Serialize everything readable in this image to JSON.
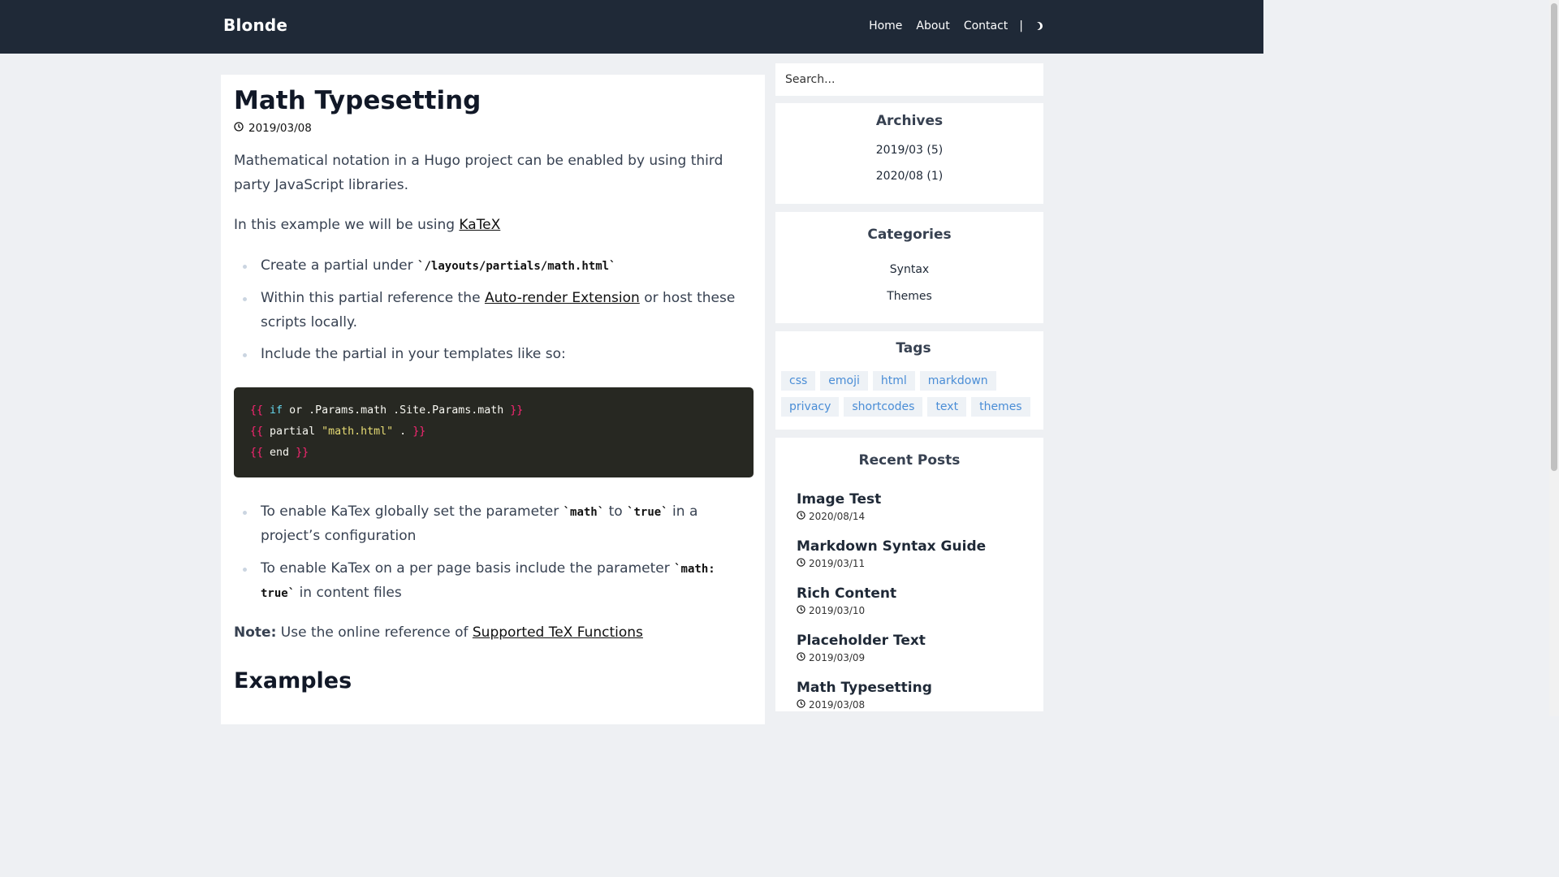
{
  "header": {
    "brand": "Blonde",
    "nav": [
      "Home",
      "About",
      "Contact"
    ],
    "separator": "|"
  },
  "article": {
    "title": "Math Typesetting",
    "date": "2019/03/08",
    "intro": "Mathematical notation in a Hugo project can be enabled by using third party JavaScript libraries.",
    "example_prefix": "In this example we will be using",
    "example_link": "KaTeX",
    "bullet1_text": "Create a partial under",
    "bullet1_code": "`/layouts/partials/math.html`",
    "bullet2_prefix": "Within this partial reference the",
    "bullet2_link": "Auto-render Extension",
    "bullet2_suffix": "or host these scripts locally.",
    "bullet3_text": "Include the partial in your templates like so:",
    "code": {
      "line1_open": "{{",
      "line1_kw": "if",
      "line1_rest": "or .Params.math .Site.Params.math",
      "line1_close": "}}",
      "line2_open": "{{",
      "line2_word": "partial",
      "line2_str": "\"math.html\"",
      "line2_rest": ".",
      "line2_close": "}}",
      "line3_open": "{{",
      "line3_word": "end",
      "line3_close": "}}"
    },
    "bullet4_prefix": "To enable KaTex globally set the parameter",
    "bullet4_code1": "`math`",
    "bullet4_mid": "to",
    "bullet4_code2": "`true`",
    "bullet4_suffix": "in a project’s configuration",
    "bullet5_prefix": "To enable KaTex on a per page basis include the parameter",
    "bullet5_code": "`math: true`",
    "bullet5_suffix": "in content files",
    "note_label": "Note:",
    "note_text": "Use the online reference of",
    "note_link": "Supported TeX Functions",
    "examples_heading": "Examples"
  },
  "sidebar": {
    "search_placeholder": "Search...",
    "archives": {
      "title": "Archives",
      "items": [
        "2019/03 (5)",
        "2020/08 (1)"
      ]
    },
    "categories": {
      "title": "Categories",
      "items": [
        "Syntax",
        "Themes"
      ]
    },
    "tags": {
      "title": "Tags",
      "items": [
        "css",
        "emoji",
        "html",
        "markdown",
        "privacy",
        "shortcodes",
        "text",
        "themes"
      ]
    },
    "recent": {
      "title": "Recent Posts",
      "posts": [
        {
          "title": "Image Test",
          "date": "2020/08/14"
        },
        {
          "title": "Markdown Syntax Guide",
          "date": "2019/03/11"
        },
        {
          "title": "Rich Content",
          "date": "2019/03/10"
        },
        {
          "title": "Placeholder Text",
          "date": "2019/03/09"
        },
        {
          "title": "Math Typesetting",
          "date": "2019/03/08"
        }
      ]
    }
  },
  "icons": {
    "clock": "clock-icon",
    "theme": "moon-icon"
  },
  "colors": {
    "header_bg": "#1f2937",
    "code_bg": "#272822",
    "tag_text": "#4a8dd6",
    "page_bg": "#eef0f3"
  }
}
